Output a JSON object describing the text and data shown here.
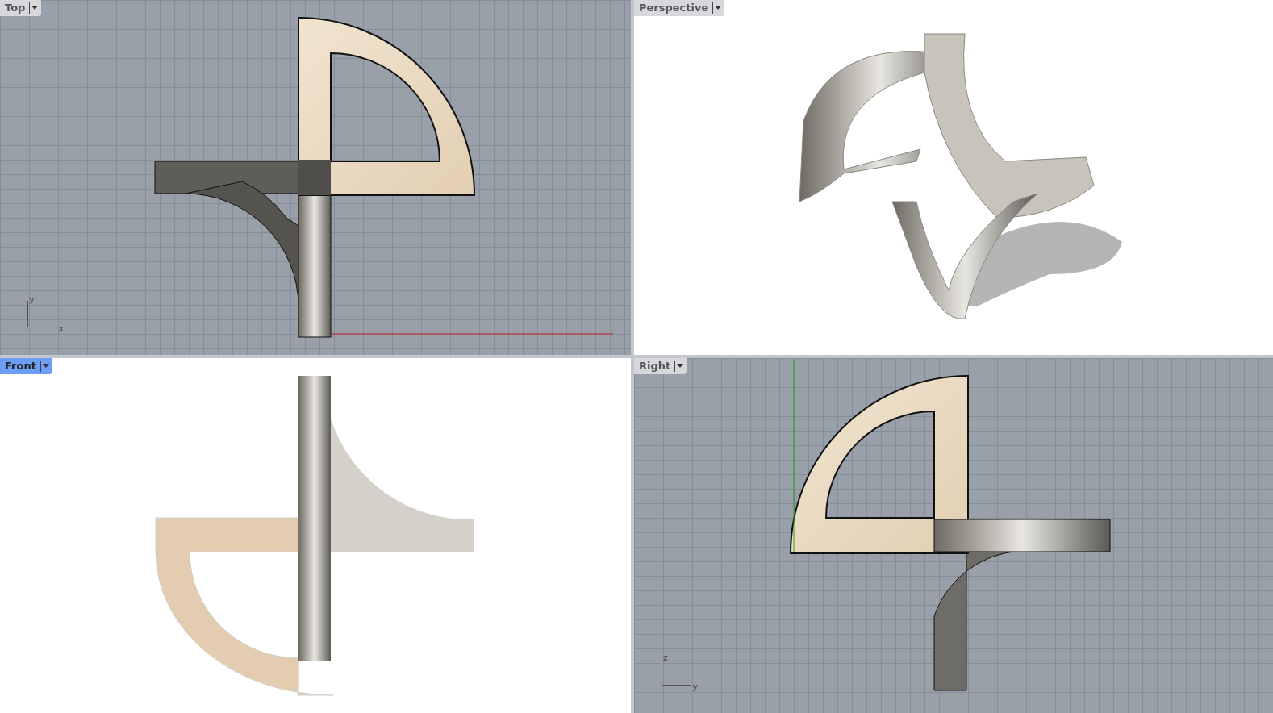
{
  "viewports": [
    {
      "label": "Top",
      "selected": false,
      "kind": "top",
      "axes": {
        "horizontal": "x",
        "vertical": "y"
      }
    },
    {
      "label": "Perspective",
      "selected": false,
      "kind": "perspective"
    },
    {
      "label": "Front",
      "selected": true,
      "kind": "front"
    },
    {
      "label": "Right",
      "selected": false,
      "kind": "right",
      "axes": {
        "horizontal": "y",
        "vertical": "z"
      }
    }
  ]
}
